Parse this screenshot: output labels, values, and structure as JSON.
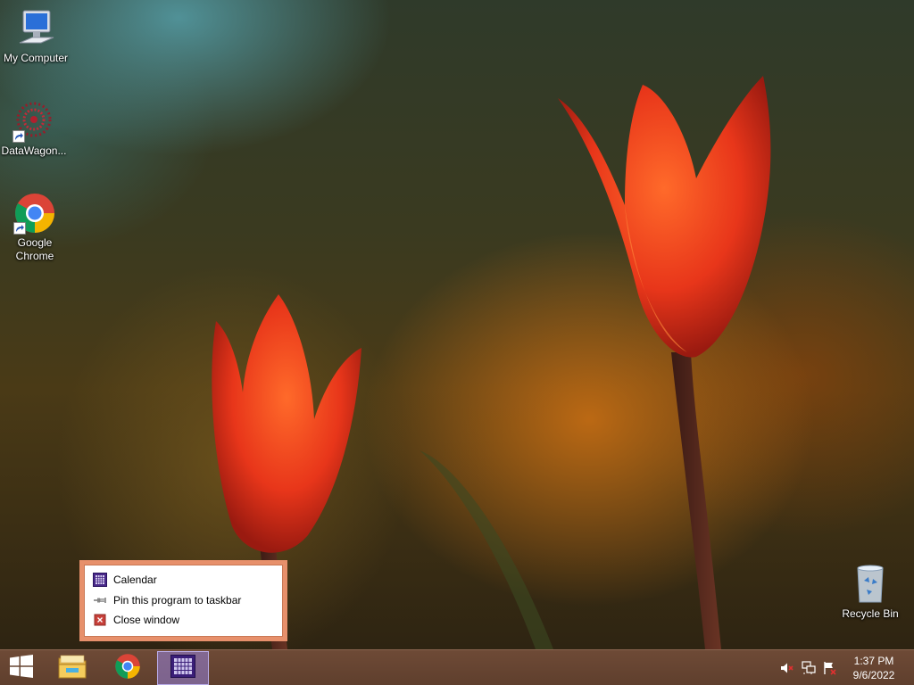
{
  "desktop": {
    "icons": [
      {
        "label": "My Computer"
      },
      {
        "label": "DataWagon..."
      },
      {
        "label": "Google\nChrome"
      },
      {
        "label": "Recycle Bin"
      }
    ]
  },
  "jumplist": {
    "items": [
      {
        "label": "Calendar",
        "icon": "calendar-icon"
      },
      {
        "label": "Pin this program to taskbar",
        "icon": "pin-icon"
      },
      {
        "label": "Close window",
        "icon": "close-icon"
      }
    ]
  },
  "taskbar": {
    "buttons": [
      {
        "name": "start",
        "icon": "windows-logo-icon"
      },
      {
        "name": "file-explorer",
        "icon": "folder-icon"
      },
      {
        "name": "chrome",
        "icon": "chrome-icon"
      },
      {
        "name": "calendar",
        "icon": "calendar-icon",
        "active": true
      }
    ],
    "tray": {
      "icons": [
        "volume-muted-icon",
        "network-icon",
        "action-center-icon"
      ],
      "time": "1:37 PM",
      "date": "9/6/2022"
    }
  },
  "colors": {
    "taskbar": "#64432f",
    "jumplist_border": "#e7906b",
    "active_button": "#9682dc"
  }
}
